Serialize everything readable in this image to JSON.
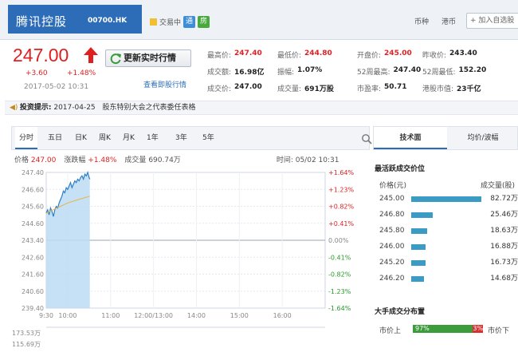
{
  "header": {
    "stock_name": "腾讯控股",
    "stock_code": "00700.HK",
    "status": "交易中",
    "badge_tong": "通",
    "badge_fang": "房",
    "link_currency": "币种",
    "link_hk": "港币",
    "add_watchlist": "+ 加入自选股"
  },
  "quote": {
    "price": "247.00",
    "change": "+3.60",
    "change_pct": "+1.48%",
    "timestamp": "2017-05-02 10:31",
    "refresh_label": "更新实时行情",
    "view_link": "查看即股行情",
    "fields": [
      {
        "key": "最高价:",
        "value": "247.40",
        "tone": "red"
      },
      {
        "key": "最低价:",
        "value": "244.80",
        "tone": "red"
      },
      {
        "key": "开盘价:",
        "value": "245.00",
        "tone": "red"
      },
      {
        "key": "昨收价:",
        "value": "243.40",
        "tone": "dark"
      },
      {
        "key": "成交额:",
        "value": "16.98亿",
        "tone": "dark"
      },
      {
        "key": "振幅:",
        "value": "1.07%",
        "tone": "dark"
      },
      {
        "key": "52周最高:",
        "value": "247.40",
        "tone": "dark"
      },
      {
        "key": "52周最低:",
        "value": "152.20",
        "tone": "dark"
      },
      {
        "key": "成交价:",
        "value": "247.00",
        "tone": "dark"
      },
      {
        "key": "成交量:",
        "value": "691万股",
        "tone": "dark"
      },
      {
        "key": "市盈率:",
        "value": "50.71",
        "tone": "dark"
      },
      {
        "key": "港股市值:",
        "value": "23千亿",
        "tone": "dark"
      }
    ]
  },
  "notice": {
    "label": "投资提示:",
    "date": "2017-04-25",
    "text": "股东特别大会之代表委任表格"
  },
  "tabs": [
    "分时",
    "五日",
    "日K",
    "周K",
    "月K",
    "1年",
    "3年",
    "5年"
  ],
  "infobar": {
    "price_label": "价格",
    "price_value": "247.00",
    "chg_label": "涨跌幅",
    "chg_value": "+1.48%",
    "vol_label": "成交量",
    "vol_value": "690.74万",
    "time_label": "时间:",
    "time_value": "05/02 10:31"
  },
  "chart_data": {
    "type": "line",
    "title": "",
    "xlabel": "",
    "ylabel": "",
    "x_ticks": [
      "9:30",
      "10:00",
      "11:00",
      "12:00/13:00",
      "14:00",
      "15:00",
      "16:00"
    ],
    "y_ticks": [
      "247.40",
      "246.60",
      "245.60",
      "244.60",
      "243.40",
      "242.60",
      "241.60",
      "240.60",
      "239.40"
    ],
    "y_ticks_right": [
      "+1.64%",
      "+1.23%",
      "+0.82%",
      "+0.41%",
      "0.00%",
      "-0.41%",
      "-0.82%",
      "-1.23%",
      "-1.64%"
    ],
    "ylim": [
      239.4,
      247.4
    ],
    "prev_close": 243.4,
    "series": [
      {
        "x": [
          0,
          2,
          4,
          6,
          8,
          10,
          12,
          14,
          16,
          18,
          20,
          22,
          24,
          26,
          28,
          30,
          32,
          34,
          36,
          38,
          40,
          42,
          44,
          46,
          48,
          50,
          52,
          54,
          56,
          58,
          60,
          61
        ],
        "values": [
          245.0,
          245.2,
          244.9,
          245.3,
          245.1,
          244.8,
          245.2,
          245.4,
          245.3,
          245.6,
          245.8,
          246.0,
          246.3,
          246.2,
          246.5,
          246.4,
          246.6,
          246.8,
          246.5,
          246.7,
          246.9,
          246.8,
          247.0,
          246.9,
          247.1,
          247.2,
          247.0,
          247.3,
          247.2,
          247.4,
          247.1,
          247.0
        ]
      },
      {
        "x": [
          0,
          15,
          30,
          45,
          61
        ],
        "values": [
          245.0,
          245.3,
          245.6,
          245.8,
          246.0
        ]
      }
    ],
    "volume_ticks": [
      "173.53万",
      "115.69万"
    ]
  },
  "right_panel": {
    "tab_active": "技术面",
    "tab_other": "均价/波幅",
    "section1": "最活跃成交价位",
    "col_price": "价格(元)",
    "col_vol": "成交量(股)",
    "rows": [
      {
        "price": "245.00",
        "vol": "82.72万",
        "share": 1.0
      },
      {
        "price": "246.80",
        "vol": "25.46万",
        "share": 0.31
      },
      {
        "price": "245.80",
        "vol": "18.63万",
        "share": 0.23
      },
      {
        "price": "246.00",
        "vol": "16.88万",
        "share": 0.2
      },
      {
        "price": "245.20",
        "vol": "16.73万",
        "share": 0.2
      },
      {
        "price": "246.20",
        "vol": "14.68万",
        "share": 0.18
      }
    ],
    "section2": "大手成交分布置",
    "up_label": "市价上",
    "up_pct": "97%",
    "down_pct": "3%",
    "down_label": "市价下",
    "up_share": 0.97
  }
}
